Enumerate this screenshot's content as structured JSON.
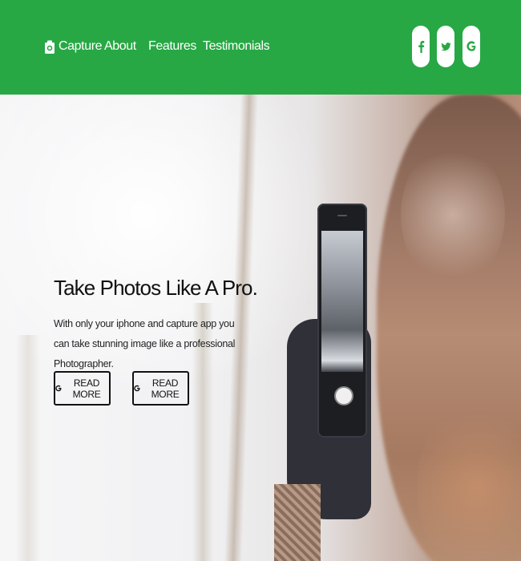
{
  "nav": {
    "brand": {
      "icon": "camera-icon",
      "label": "Capture"
    },
    "links": [
      {
        "label": "About"
      },
      {
        "label": "Features"
      },
      {
        "label": "Testimonials"
      }
    ],
    "social": [
      {
        "icon": "facebook-icon"
      },
      {
        "icon": "twitter-icon"
      },
      {
        "icon": "google-icon"
      }
    ]
  },
  "hero": {
    "title": "Take Photos Like A Pro.",
    "subtitle": "With only your iphone and capture app you can take stunning image like a professional Photographer.",
    "buttons": [
      {
        "icon": "google-icon",
        "label": "READ MORE"
      },
      {
        "icon": "google-icon",
        "label": "READ MORE"
      }
    ]
  },
  "colors": {
    "nav_bg": "#27a844",
    "text": "#111111",
    "white": "#ffffff"
  }
}
